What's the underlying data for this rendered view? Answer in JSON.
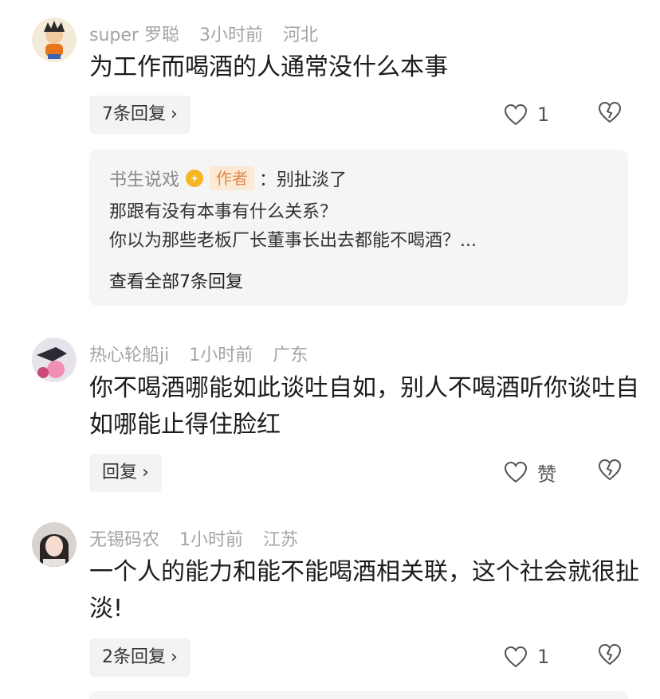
{
  "comments": [
    {
      "username": "super 罗聪",
      "time": "3小时前",
      "location": "河北",
      "text": "为工作而喝酒的人通常没什么本事",
      "reply_label": "7条回复",
      "like_count": "1",
      "avatar_icon": "cartoon-avatar",
      "sub_reply": {
        "name": "书生说戏",
        "badge_icon": "level-badge-icon",
        "author_tag": "作者",
        "lines": [
          "：别扯淡了",
          "那跟有没有本事有什么关系？",
          "你以为那些老板厂长董事长出去都能不喝酒？..."
        ],
        "view_all": "查看全部7条回复"
      }
    },
    {
      "username": "热心轮船ji",
      "time": "1小时前",
      "location": "广东",
      "text": "你不喝酒哪能如此谈吐自如，别人不喝酒听你谈吐自如哪能止得住脸红",
      "reply_label": "回复",
      "like_count": "赞",
      "avatar_icon": "photo-avatar"
    },
    {
      "username": "无锡码农",
      "time": "1小时前",
      "location": "江苏",
      "text": "一个人的能力和能不能喝酒相关联，这个社会就很扯淡!",
      "reply_label": "2条回复",
      "like_count": "1",
      "avatar_icon": "portrait-avatar"
    }
  ],
  "icons": {
    "like": "heart-icon",
    "dislike": "broken-heart-icon",
    "chevron": "chevron-right-icon"
  },
  "colors": {
    "meta_gray": "#a3a3a3",
    "author_tag_bg": "#fbe9d3",
    "author_tag_text": "#e0894a",
    "badge": "#f5b623"
  }
}
